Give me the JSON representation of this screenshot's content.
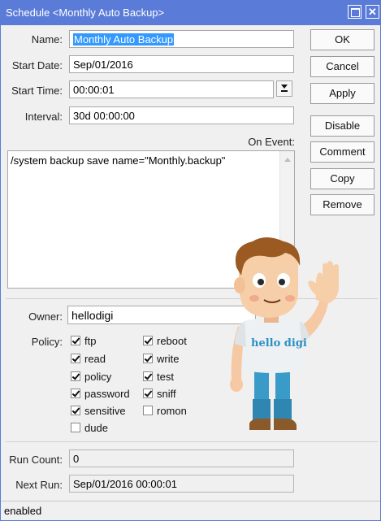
{
  "window": {
    "title": "Schedule <Monthly Auto Backup>"
  },
  "form": {
    "name_label": "Name:",
    "name_value": "Monthly Auto Backup",
    "start_date_label": "Start Date:",
    "start_date_value": "Sep/01/2016",
    "start_time_label": "Start Time:",
    "start_time_value": "00:00:01",
    "interval_label": "Interval:",
    "interval_value": "30d 00:00:00",
    "on_event_label": "On Event:",
    "on_event_value": "/system backup save name=\"Monthly.backup\"",
    "owner_label": "Owner:",
    "owner_value": "hellodigi",
    "policy_label": "Policy:",
    "run_count_label": "Run Count:",
    "run_count_value": "0",
    "next_run_label": "Next Run:",
    "next_run_value": "Sep/01/2016 00:00:01"
  },
  "policies": [
    {
      "label": "ftp",
      "checked": true
    },
    {
      "label": "reboot",
      "checked": true
    },
    {
      "label": "read",
      "checked": true
    },
    {
      "label": "write",
      "checked": true
    },
    {
      "label": "policy",
      "checked": true
    },
    {
      "label": "test",
      "checked": true
    },
    {
      "label": "password",
      "checked": true
    },
    {
      "label": "sniff",
      "checked": true
    },
    {
      "label": "sensitive",
      "checked": true
    },
    {
      "label": "romon",
      "checked": false
    },
    {
      "label": "dude",
      "checked": false
    }
  ],
  "buttons": {
    "ok": "OK",
    "cancel": "Cancel",
    "apply": "Apply",
    "disable": "Disable",
    "comment": "Comment",
    "copy": "Copy",
    "remove": "Remove"
  },
  "status": {
    "text": "enabled"
  },
  "overlay": {
    "shirt_text": "hello digi"
  }
}
